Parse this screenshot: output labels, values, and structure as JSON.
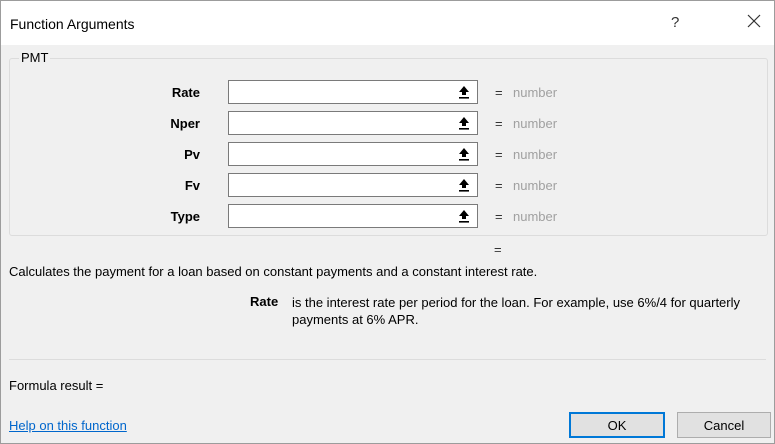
{
  "window": {
    "title": "Function Arguments",
    "help_glyph": "?",
    "close_icon": "close-icon"
  },
  "group": {
    "label": "PMT",
    "arguments": [
      {
        "label": "Rate",
        "value": "",
        "equals": "=",
        "result": "number"
      },
      {
        "label": "Nper",
        "value": "",
        "equals": "=",
        "result": "number"
      },
      {
        "label": "Pv",
        "value": "",
        "equals": "=",
        "result": "number"
      },
      {
        "label": "Fv",
        "value": "",
        "equals": "=",
        "result": "number"
      },
      {
        "label": "Type",
        "value": "",
        "equals": "=",
        "result": "number"
      }
    ]
  },
  "result_equals": "=",
  "description": "Calculates the payment for a loan based on constant payments and a constant interest rate.",
  "arg_help": {
    "name": "Rate",
    "text": "is the interest rate per period for the loan. For example, use 6%/4 for quarterly payments at 6% APR."
  },
  "formula_result": "Formula result =",
  "help_link": "Help on this function",
  "buttons": {
    "ok": "OK",
    "cancel": "Cancel"
  },
  "colors": {
    "accent": "#0078d7",
    "link": "#0066cc",
    "muted_text": "#a0a0a0"
  }
}
